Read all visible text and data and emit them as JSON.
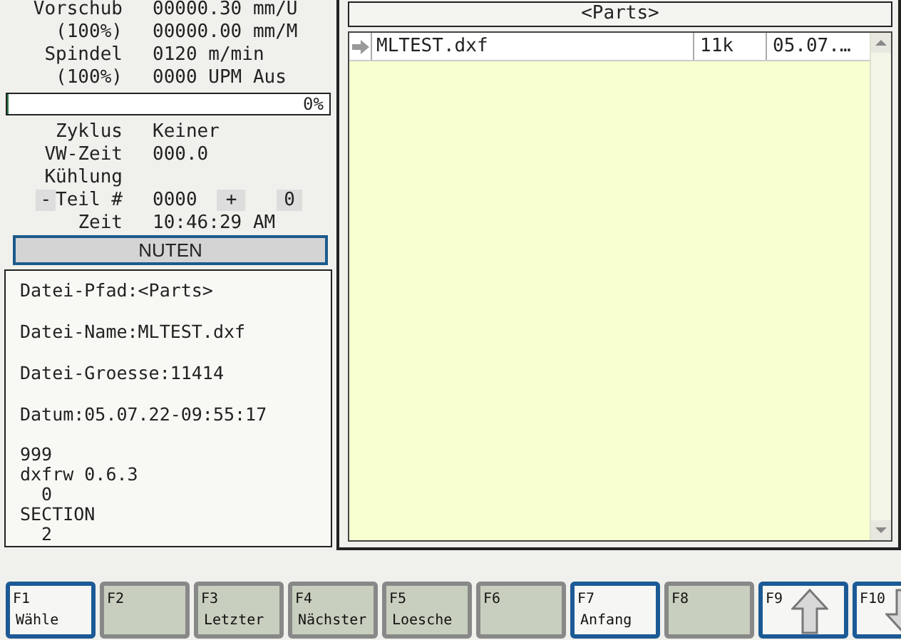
{
  "status": {
    "rows": [
      {
        "label": "Vorschub",
        "value": "00000.30 mm/U"
      },
      {
        "label": "(100%)",
        "value": "00000.00 mm/M"
      },
      {
        "label": "Spindel",
        "value": "0120 m/min"
      },
      {
        "label": "(100%)",
        "value": "0000 UPM Aus"
      }
    ],
    "progress": {
      "level": 0,
      "reading": "0%"
    },
    "rows2": [
      {
        "label": "Zyklus",
        "value": "Keiner"
      },
      {
        "label": "VW-Zeit",
        "value": "000.0"
      },
      {
        "label": "Kühlung"
      }
    ],
    "part_counter": {
      "minus": "-",
      "label": "Teil #",
      "value": "0000",
      "plus": "+",
      "reset": "0"
    },
    "time": {
      "label": "Zeit",
      "value": "10:46:29 AM"
    },
    "mode": "NUTEN"
  },
  "file_info": {
    "fields": [
      "Datei-Pfad:<Parts>",
      "Datei-Name:MLTEST.dxf",
      "Datei-Groesse:11414",
      "Datum:05.07.22-09:55:17"
    ],
    "preview": [
      "999",
      "dxfrw 0.6.3",
      "  0",
      "SECTION",
      "  2"
    ]
  },
  "files": {
    "header": "<Parts>",
    "rows": [
      {
        "name": "MLTEST.dxf",
        "size": "11k",
        "date": "05.07.…",
        "selected": true
      }
    ]
  },
  "function_keys": [
    {
      "key": "F1",
      "label": "Wähle",
      "enabled": true,
      "kind": "text"
    },
    {
      "key": "F2",
      "enabled": false,
      "kind": "text"
    },
    {
      "key": "F3",
      "label": "Letzter",
      "enabled": false,
      "kind": "text"
    },
    {
      "key": "F4",
      "label": "Nächster",
      "enabled": false,
      "kind": "text"
    },
    {
      "key": "F5",
      "label": "Loesche",
      "enabled": false,
      "kind": "text"
    },
    {
      "key": "F6",
      "enabled": false,
      "kind": "text"
    },
    {
      "key": "F7",
      "label": "Anfang",
      "enabled": true,
      "kind": "text"
    },
    {
      "key": "F8",
      "enabled": false,
      "kind": "text"
    },
    {
      "key": "F9",
      "enabled": true,
      "kind": "arrow-up"
    },
    {
      "key": "F10",
      "enabled": true,
      "kind": "arrow-down"
    }
  ]
}
